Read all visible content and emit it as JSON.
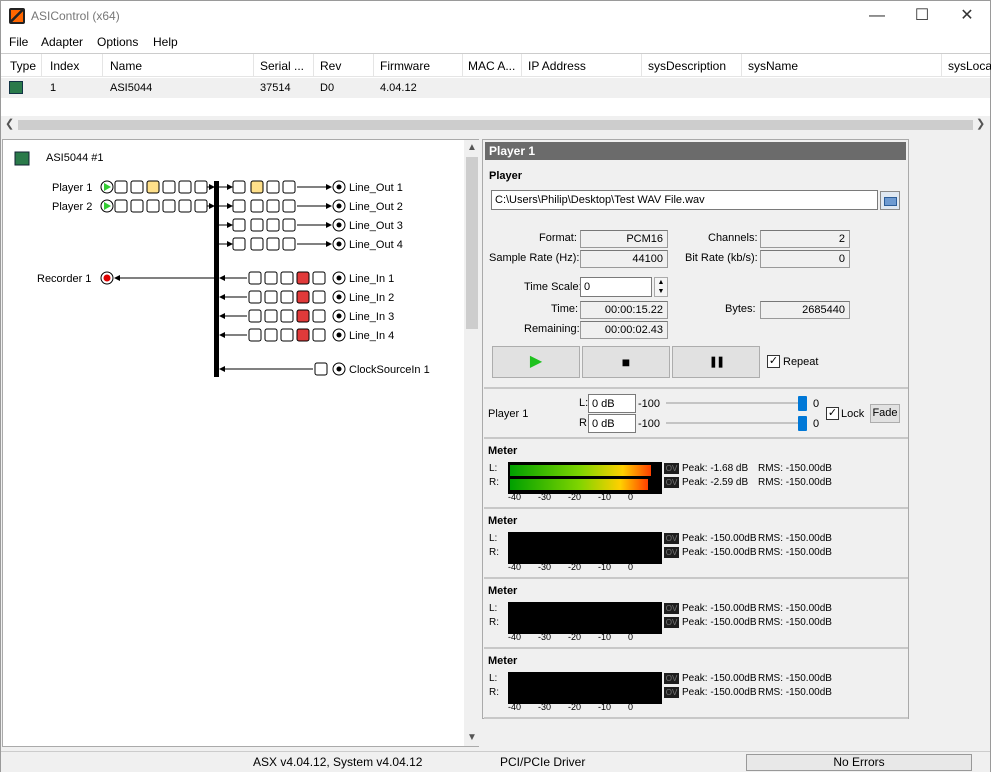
{
  "title": "ASIControl (x64)",
  "window": {
    "min": "—",
    "max": "☐",
    "close": "✕"
  },
  "menu": [
    "File",
    "Adapter",
    "Options",
    "Help"
  ],
  "grid": {
    "headers": [
      "Type",
      "Index",
      "Name",
      "Serial ...",
      "Rev",
      "Firmware",
      "MAC A...",
      "IP Address",
      "sysDescription",
      "sysName",
      "sysLoca"
    ],
    "row": {
      "index": "1",
      "name": "ASI5044",
      "serial": "37514",
      "rev": "D0",
      "firmware": "4.04.12"
    }
  },
  "tree": {
    "adapter": "ASI5044 #1",
    "players": [
      "Player  1",
      "Player  2"
    ],
    "recorder": "Recorder  1",
    "outputs": [
      "Line_Out  1",
      "Line_Out  2",
      "Line_Out  3",
      "Line_Out  4"
    ],
    "inputs": [
      "Line_In  1",
      "Line_In  2",
      "Line_In  3",
      "Line_In  4"
    ],
    "clock": "ClockSourceIn  1"
  },
  "player": {
    "panel_title": "Player  1",
    "section": "Player",
    "file": "C:\\Users\\Philip\\Desktop\\Test WAV File.wav",
    "format_label": "Format:",
    "format": "PCM16",
    "channels_label": "Channels:",
    "channels": "2",
    "rate_label": "Sample Rate (Hz):",
    "rate": "44100",
    "bitrate_label": "Bit Rate (kb/s):",
    "bitrate": "0",
    "timescale_label": "Time Scale:",
    "timescale": "0",
    "time_label": "Time:",
    "time": "00:00:15.22",
    "bytes_label": "Bytes:",
    "bytes": "2685440",
    "remaining_label": "Remaining:",
    "remaining": "00:00:02.43",
    "play": "▶",
    "stop": "■",
    "pause": "❚❚",
    "repeat": "Repeat"
  },
  "volume": {
    "label": "Player  1",
    "l": "L:",
    "r": "R:",
    "l_db": "0 dB",
    "r_db": "0 dB",
    "min": "-100",
    "max": "0",
    "lock": "Lock",
    "fade": "Fade",
    "l_level": 1.0,
    "r_level": 1.0
  },
  "meters": [
    {
      "title": "Meter",
      "l": "L:",
      "r": "R:",
      "ovl": "OV",
      "ovr": "OV",
      "peak_l": "Peak:  -1.68 dB",
      "peak_r": "Peak:  -2.59 dB",
      "rms_l": "RMS: -150.00dB",
      "rms_r": "RMS: -150.00dB",
      "level_l": 0.94,
      "level_r": 0.92
    },
    {
      "title": "Meter",
      "l": "L:",
      "r": "R:",
      "ovl": "OV",
      "ovr": "OV",
      "peak_l": "Peak: -150.00dB",
      "peak_r": "Peak: -150.00dB",
      "rms_l": "RMS: -150.00dB",
      "rms_r": "RMS: -150.00dB",
      "level_l": 0,
      "level_r": 0
    },
    {
      "title": "Meter",
      "l": "L:",
      "r": "R:",
      "ovl": "OV",
      "ovr": "OV",
      "peak_l": "Peak: -150.00dB",
      "peak_r": "Peak: -150.00dB",
      "rms_l": "RMS: -150.00dB",
      "rms_r": "RMS: -150.00dB",
      "level_l": 0,
      "level_r": 0
    },
    {
      "title": "Meter",
      "l": "L:",
      "r": "R:",
      "ovl": "OV",
      "ovr": "OV",
      "peak_l": "Peak: -150.00dB",
      "peak_r": "Peak: -150.00dB",
      "rms_l": "RMS: -150.00dB",
      "rms_r": "RMS: -150.00dB",
      "level_l": 0,
      "level_r": 0
    }
  ],
  "meter_scale": [
    "-40",
    "-30",
    "-20",
    "-10",
    "0"
  ],
  "status": {
    "version": "ASX v4.04.12, System v4.04.12",
    "driver": "PCI/PCIe Driver",
    "errors": "No Errors"
  }
}
